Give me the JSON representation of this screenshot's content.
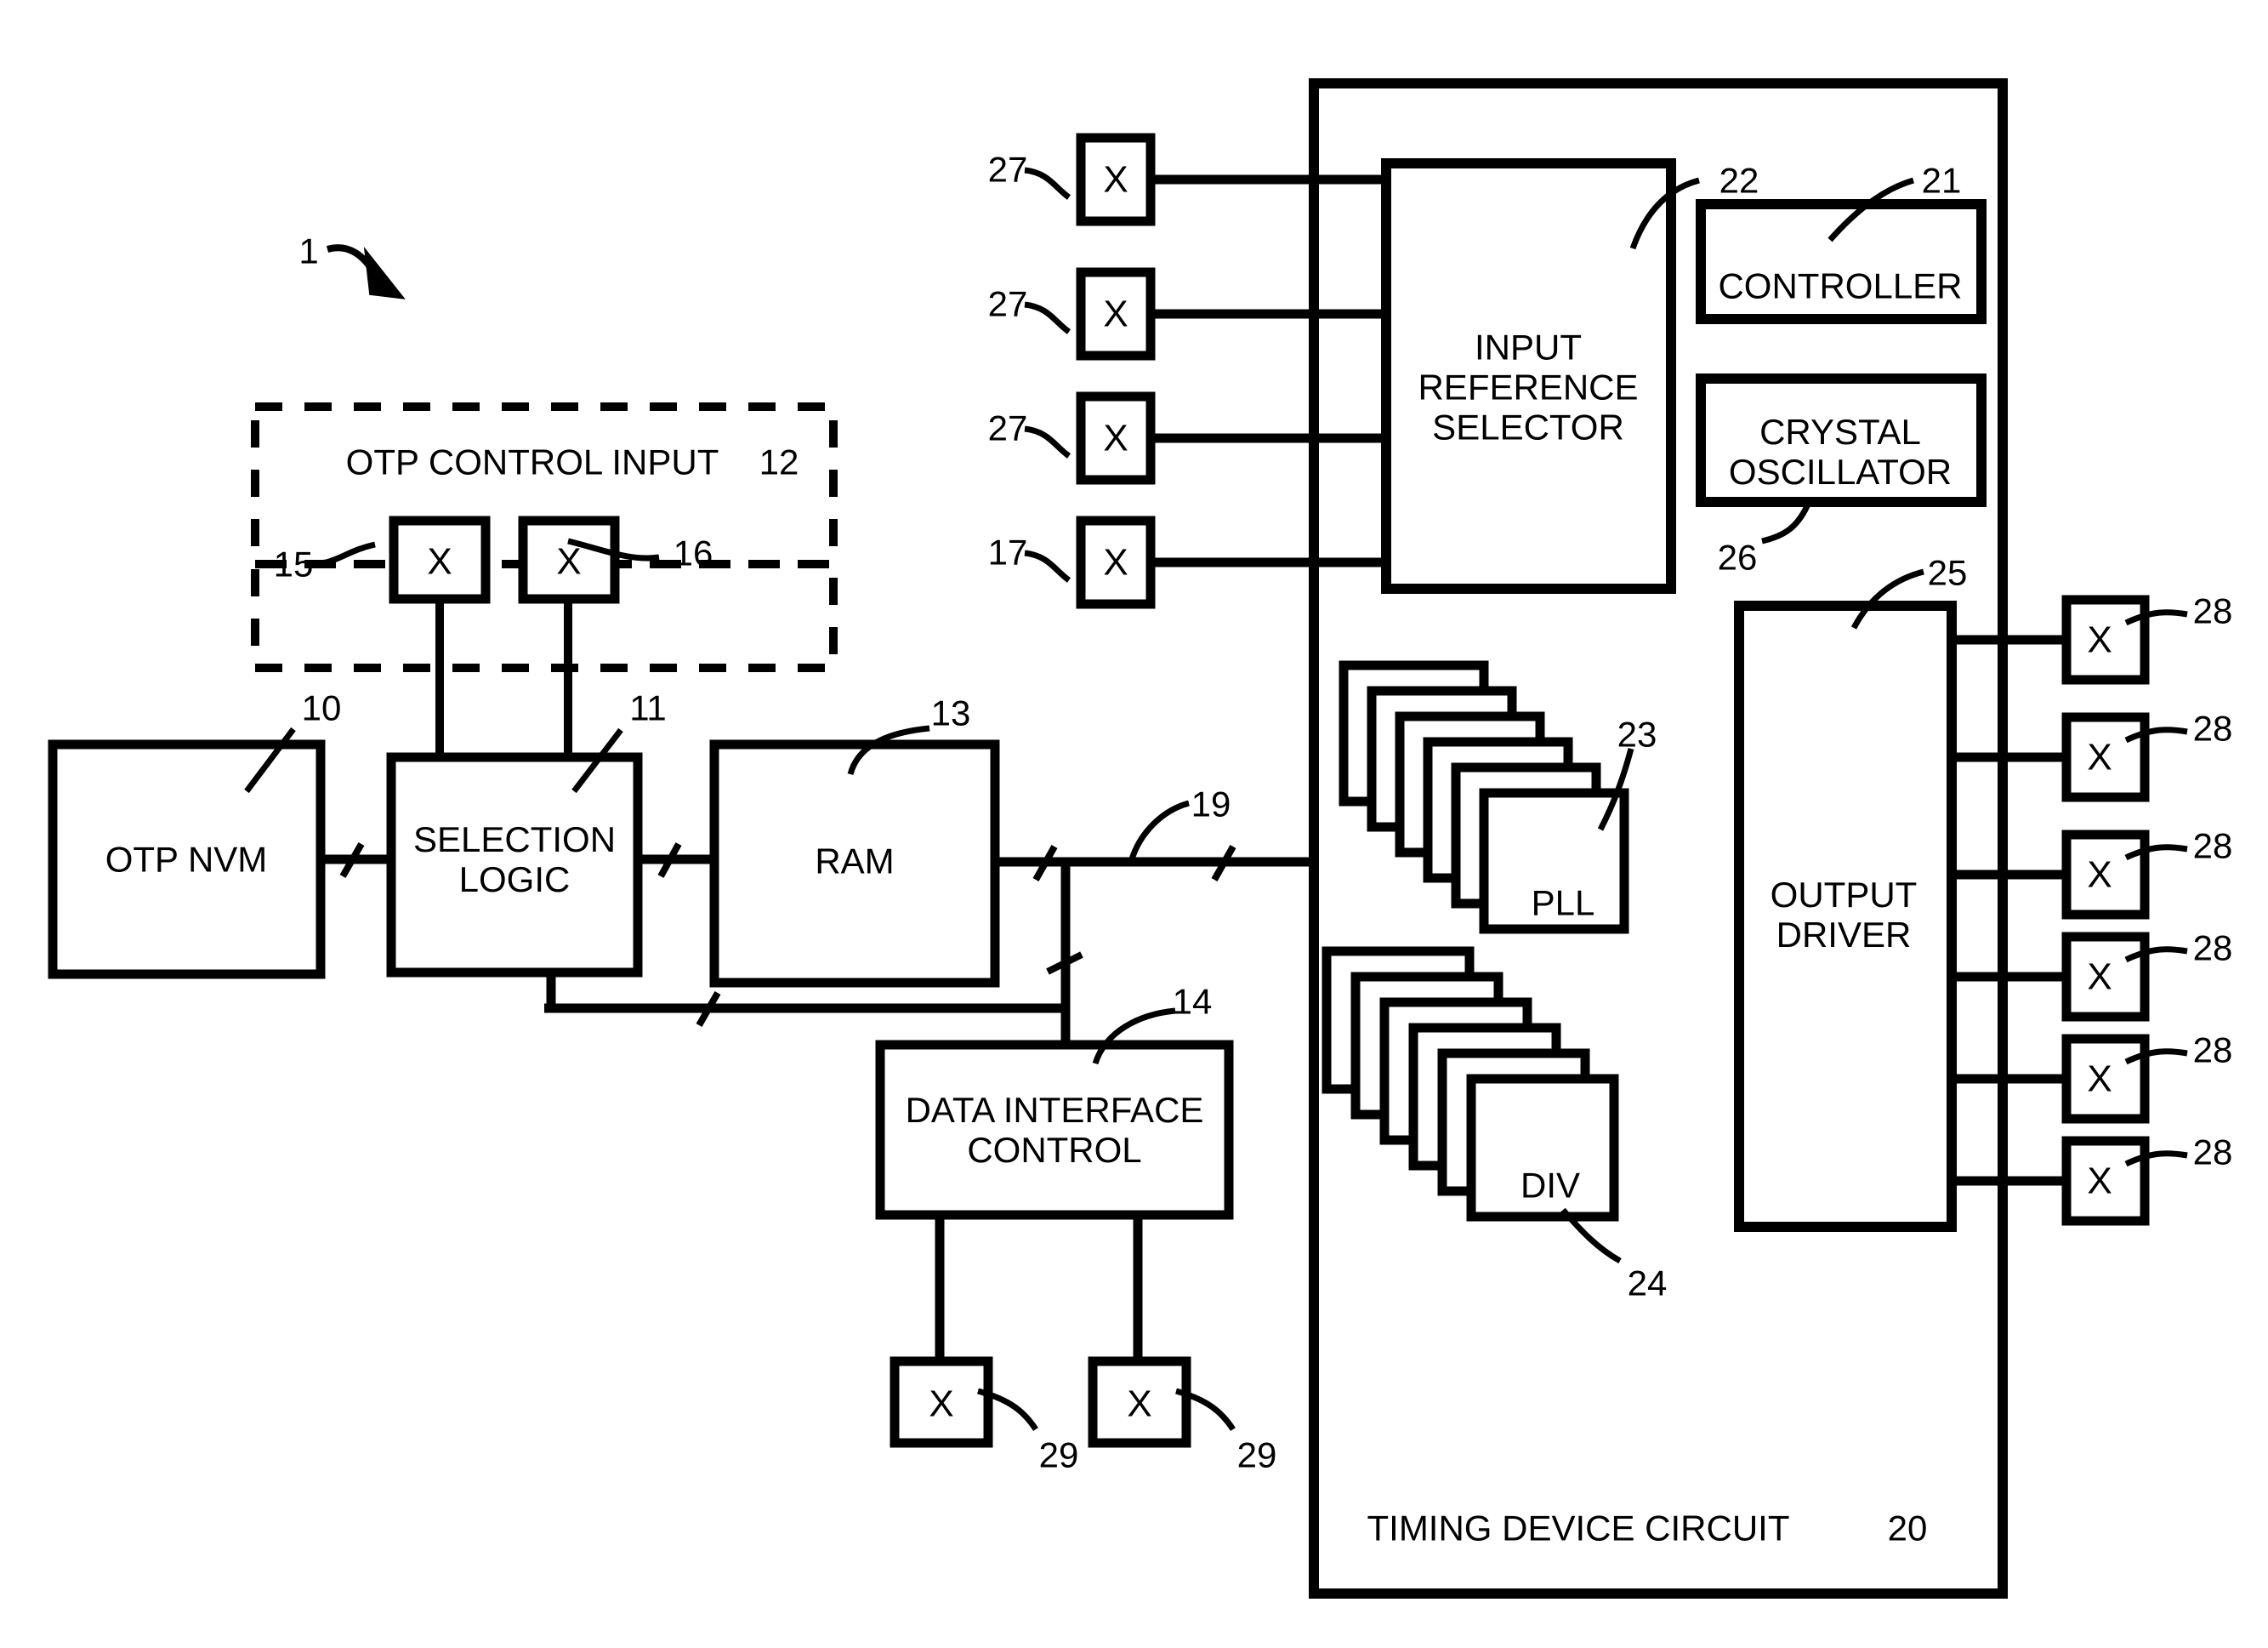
{
  "figure": {
    "figure_reference": "1",
    "otp_control_group": {
      "label": "OTP CONTROL INPUT",
      "reference": "12",
      "pins": [
        {
          "glyph": "X",
          "reference": "15"
        },
        {
          "glyph": "X",
          "reference": "16"
        }
      ]
    },
    "left_blocks": [
      {
        "label": "OTP NVM",
        "reference": "10"
      },
      {
        "label": "SELECTION\nLOGIC",
        "reference": "11"
      },
      {
        "label": "RAM",
        "reference": "13"
      },
      {
        "label": "DATA INTERFACE\nCONTROL",
        "reference": "14"
      }
    ],
    "bus_reference": "19",
    "data_interface_pins": [
      {
        "glyph": "X",
        "reference": "29"
      },
      {
        "glyph": "X",
        "reference": "29"
      }
    ],
    "timing_device": {
      "label": "TIMING DEVICE CIRCUIT",
      "reference": "20",
      "blocks": [
        {
          "label": "INPUT\nREFERENCE\nSELECTOR",
          "reference": "22"
        },
        {
          "label": "CONTROLLER",
          "reference": "21"
        },
        {
          "label": "CRYSTAL\nOSCILLATOR",
          "reference": "26"
        },
        {
          "label": "OUTPUT\nDRIVER",
          "reference": "25"
        }
      ],
      "stacks": [
        {
          "label": "PLL",
          "reference": "23",
          "layers": 6
        },
        {
          "label": "DIV",
          "reference": "24",
          "layers": 6
        }
      ]
    },
    "input_pins": [
      {
        "glyph": "X",
        "reference": "27"
      },
      {
        "glyph": "X",
        "reference": "27"
      },
      {
        "glyph": "X",
        "reference": "27"
      },
      {
        "glyph": "X",
        "reference": "17"
      }
    ],
    "output_pins": [
      {
        "glyph": "X",
        "reference": "28"
      },
      {
        "glyph": "X",
        "reference": "28"
      },
      {
        "glyph": "X",
        "reference": "28"
      },
      {
        "glyph": "X",
        "reference": "28"
      },
      {
        "glyph": "X",
        "reference": "28"
      },
      {
        "glyph": "X",
        "reference": "28"
      }
    ]
  },
  "colors": {
    "ink": "#000000",
    "paper": "#ffffff"
  }
}
